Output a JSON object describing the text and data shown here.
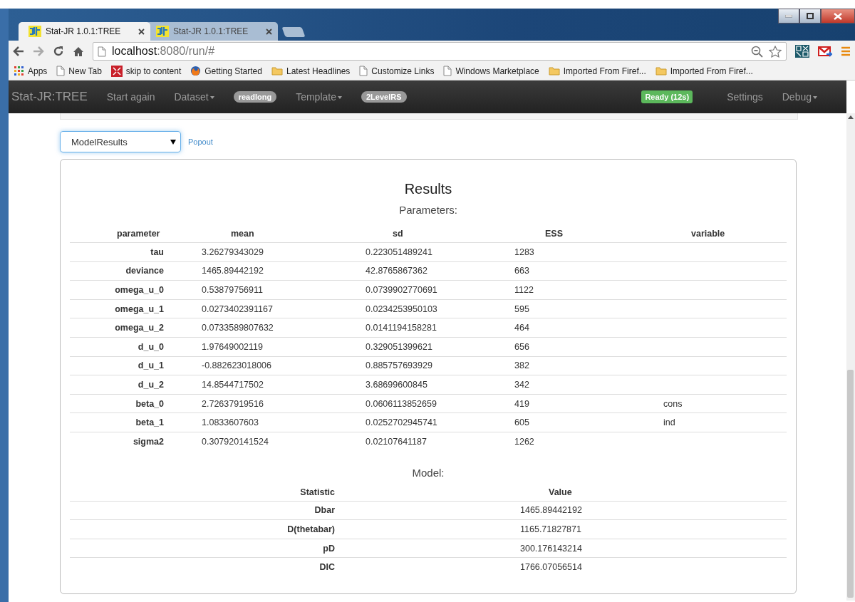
{
  "browser": {
    "tabs": [
      {
        "title": "Stat-JR 1.0.1:TREE",
        "selected": true
      },
      {
        "title": "Stat-JR 1.0.1:TREE",
        "selected": false
      }
    ],
    "address": {
      "host": "localhost",
      "rest": ":8080/run/#"
    },
    "bookmarks": [
      {
        "kind": "apps",
        "label": "Apps"
      },
      {
        "kind": "page",
        "label": "New Tab"
      },
      {
        "kind": "skip",
        "label": "skip to content"
      },
      {
        "kind": "firefox",
        "label": "Getting Started"
      },
      {
        "kind": "folder",
        "label": "Latest Headlines"
      },
      {
        "kind": "page",
        "label": "Customize Links"
      },
      {
        "kind": "page",
        "label": "Windows Marketplace"
      },
      {
        "kind": "folder",
        "label": "Imported From Firef..."
      },
      {
        "kind": "folder",
        "label": "Imported From Firef..."
      }
    ]
  },
  "navbar": {
    "brand": "Stat-JR:TREE",
    "items": [
      {
        "kind": "link",
        "label": "Start again"
      },
      {
        "kind": "dropdown",
        "label": "Dataset"
      },
      {
        "kind": "badge",
        "label": "readlong"
      },
      {
        "kind": "dropdown",
        "label": "Template"
      },
      {
        "kind": "badge",
        "label": "2LevelRS"
      }
    ],
    "status": "Ready (12s)",
    "right_items": [
      {
        "kind": "link",
        "label": "Settings"
      },
      {
        "kind": "dropdown",
        "label": "Debug"
      }
    ]
  },
  "view_select": {
    "value": "ModelResults"
  },
  "popout": "Popout",
  "results": {
    "title": "Results",
    "parameters_heading": "Parameters:",
    "columns": [
      "parameter",
      "mean",
      "sd",
      "ESS",
      "variable"
    ],
    "rows": [
      [
        "tau",
        "3.26279343029",
        "0.223051489241",
        "1283",
        ""
      ],
      [
        "deviance",
        "1465.89442192",
        "42.8765867362",
        "663",
        ""
      ],
      [
        "omega_u_0",
        "0.53879756911",
        "0.0739902770691",
        "1122",
        ""
      ],
      [
        "omega_u_1",
        "0.0273402391167",
        "0.0234253950103",
        "595",
        ""
      ],
      [
        "omega_u_2",
        "0.0733589807632",
        "0.0141194158281",
        "464",
        ""
      ],
      [
        "d_u_0",
        "1.97649002119",
        "0.329051399621",
        "656",
        ""
      ],
      [
        "d_u_1",
        "-0.882623018006",
        "0.885757693929",
        "382",
        ""
      ],
      [
        "d_u_2",
        "14.8544717502",
        "3.68699600845",
        "342",
        ""
      ],
      [
        "beta_0",
        "2.72637919516",
        "0.0606113852659",
        "419",
        "cons"
      ],
      [
        "beta_1",
        "1.0833607603",
        "0.0252702945741",
        "605",
        "ind"
      ],
      [
        "sigma2",
        "0.307920141524",
        "0.02107641187",
        "1262",
        ""
      ]
    ],
    "model_heading": "Model:",
    "model_columns": [
      "Statistic",
      "Value"
    ],
    "model_rows": [
      [
        "Dbar",
        "1465.89442192"
      ],
      [
        "D(thetabar)",
        "1165.71827871"
      ],
      [
        "pD",
        "300.176143214"
      ],
      [
        "DIC",
        "1766.07056514"
      ]
    ]
  }
}
